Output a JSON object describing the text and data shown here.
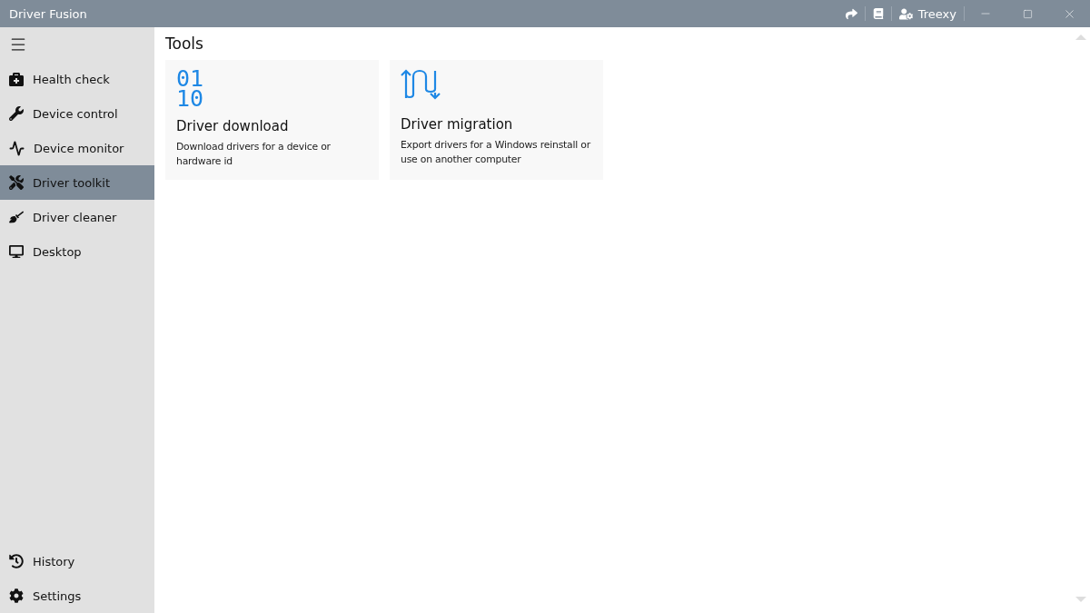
{
  "window": {
    "title": "Driver Fusion"
  },
  "toolbar": {
    "user": "Treexy"
  },
  "sidebar": {
    "items": [
      {
        "label": "Health check",
        "selected": false
      },
      {
        "label": "Device control",
        "selected": false
      },
      {
        "label": "Device monitor",
        "selected": false
      },
      {
        "label": "Driver toolkit",
        "selected": true
      },
      {
        "label": "Driver cleaner",
        "selected": false
      },
      {
        "label": "Desktop",
        "selected": false
      }
    ],
    "bottom_items": [
      {
        "label": "History",
        "selected": false
      },
      {
        "label": "Settings",
        "selected": false
      }
    ]
  },
  "page": {
    "title": "Tools",
    "cards": [
      {
        "kind": "digits",
        "icon_lines": [
          "01",
          "10"
        ],
        "title": "Driver download",
        "description": "Download drivers for a device or hardware id"
      },
      {
        "kind": "arrows",
        "title": "Driver migration",
        "description": "Export drivers for a Windows reinstall or use on another computer"
      }
    ]
  }
}
